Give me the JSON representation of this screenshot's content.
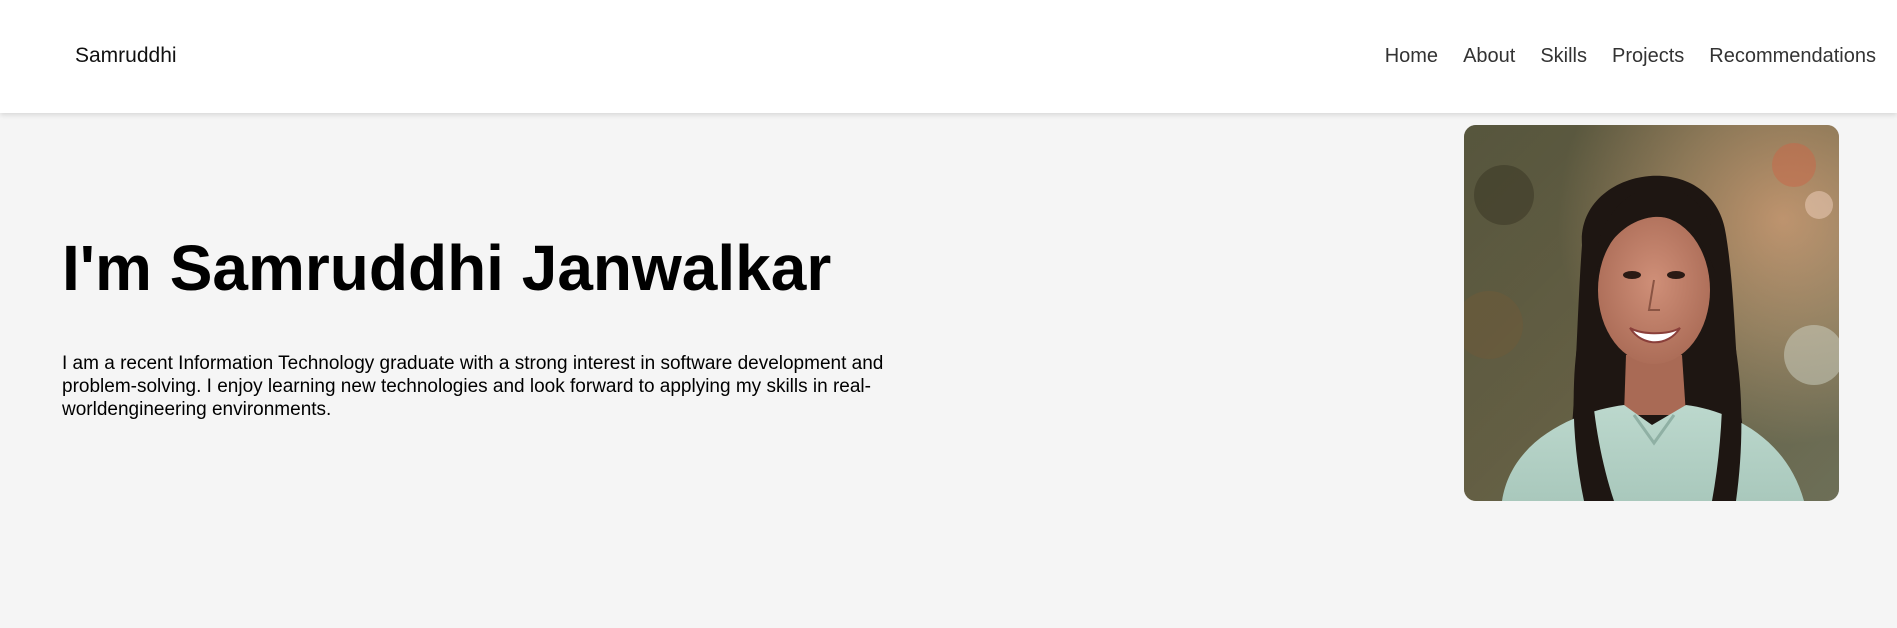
{
  "header": {
    "brand": "Samruddhi",
    "nav": [
      {
        "label": "Home"
      },
      {
        "label": "About"
      },
      {
        "label": "Skills"
      },
      {
        "label": "Projects"
      },
      {
        "label": "Recommendations"
      }
    ]
  },
  "hero": {
    "title": "I'm Samruddhi Janwalkar",
    "description": "I am a recent Information Technology graduate with a strong interest in software development and problem-solving. I enjoy learning new technologies and look forward to applying my skills in real-worldengineering environments.",
    "portrait_icon": "profile-photo-icon"
  },
  "colors": {
    "header_bg": "#ffffff",
    "page_bg": "#f5f5f5",
    "text": "#000000",
    "nav_text": "#333333"
  }
}
